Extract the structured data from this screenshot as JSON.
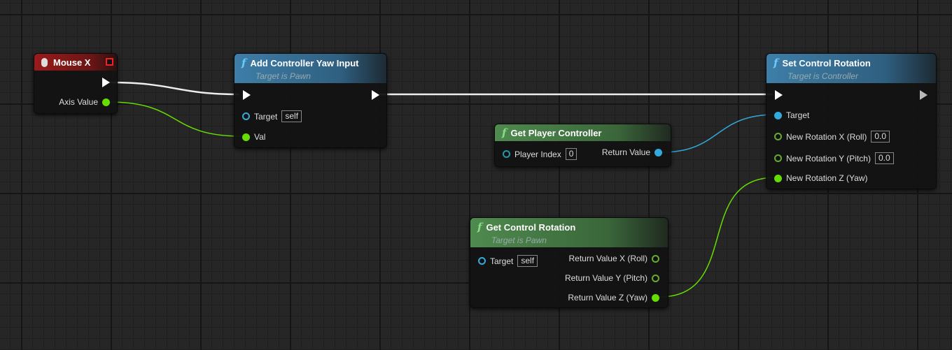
{
  "nodes": {
    "mouse_x": {
      "title": "Mouse X",
      "pins": {
        "axis_value": "Axis Value"
      }
    },
    "add_yaw": {
      "title": "Add Controller Yaw Input",
      "subtitle": "Target is Pawn",
      "pins": {
        "target": "Target",
        "target_value": "self",
        "val": "Val"
      }
    },
    "get_player_controller": {
      "title": "Get Player Controller",
      "pins": {
        "player_index": "Player Index",
        "player_index_value": "0",
        "return_value": "Return Value"
      }
    },
    "set_control_rotation": {
      "title": "Set Control Rotation",
      "subtitle": "Target is Controller",
      "pins": {
        "target": "Target",
        "x": "New Rotation X (Roll)",
        "x_value": "0.0",
        "y": "New Rotation Y (Pitch)",
        "y_value": "0.0",
        "z": "New Rotation Z (Yaw)"
      }
    },
    "get_control_rotation": {
      "title": "Get Control Rotation",
      "subtitle": "Target is Pawn",
      "pins": {
        "target": "Target",
        "target_value": "self",
        "rx": "Return Value X (Roll)",
        "ry": "Return Value Y (Pitch)",
        "rz": "Return Value Z (Yaw)"
      }
    }
  },
  "colors": {
    "exec": "#ffffff",
    "float": "#66dd00",
    "object": "#33aadd",
    "function_header": "#3e7ea8",
    "pure_header": "#4f8a4f",
    "event_header": "#9a1a1a"
  },
  "icons": {
    "function": "f-icon",
    "event": "mouse-icon"
  }
}
